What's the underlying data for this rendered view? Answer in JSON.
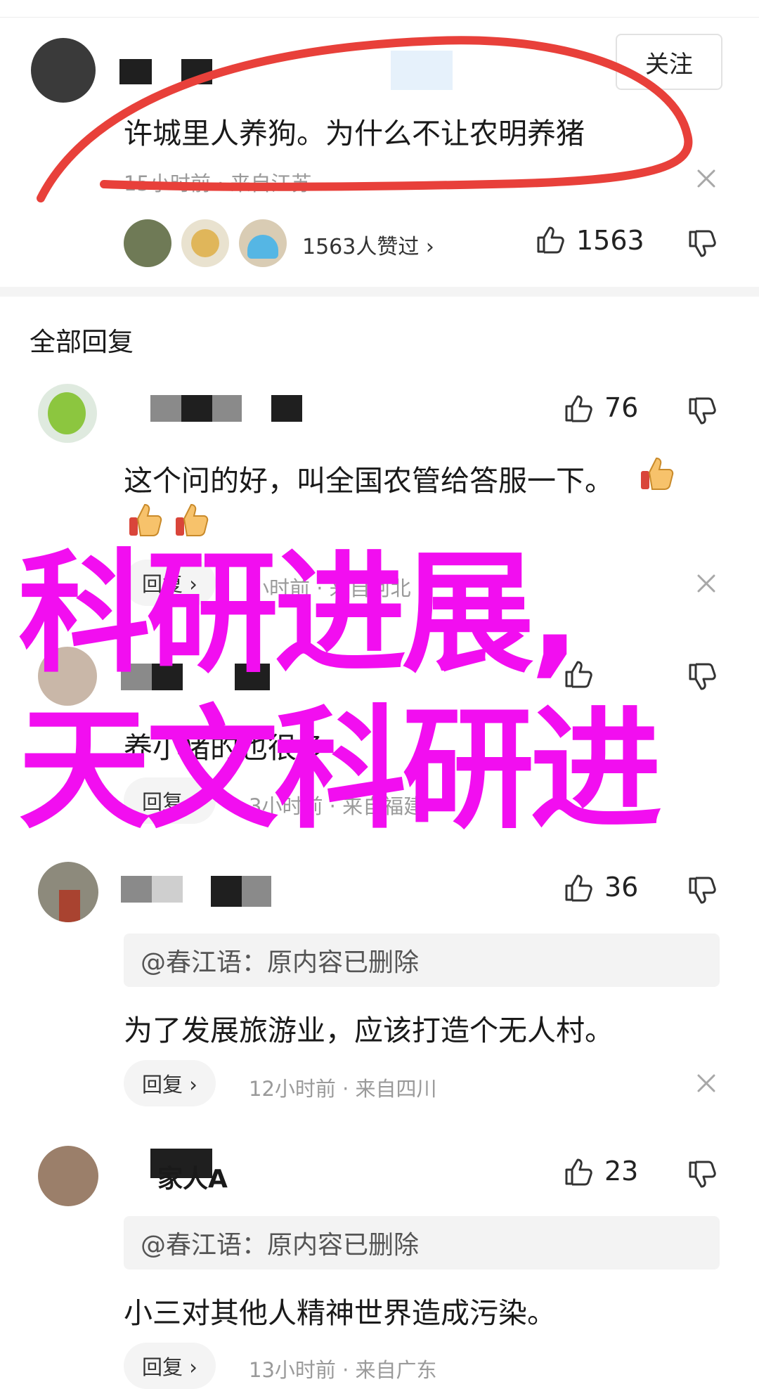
{
  "colors": {
    "watermark": "#f20ef0",
    "annotation": "#e8403a",
    "meta": "#9a9a9a"
  },
  "top_comment": {
    "text": "许城里人养狗。为什么不让农明养猪",
    "meta": "15小时前 · 来自江苏",
    "follow_label": "关注",
    "likers_text": "1563人赞过 ›",
    "like_count": "1563"
  },
  "section_title": "全部回复",
  "replies": [
    {
      "likes": "76",
      "text_line1": "这个问的好，叫全国农管给答服一下。",
      "reply_label": "回复 ›",
      "meta": "小时前 · 来自河北"
    },
    {
      "likes": "",
      "text": "养小猪的也很多",
      "reply_label": "回复 ›",
      "meta": "3小时前 · 来自福建"
    },
    {
      "likes": "36",
      "quote": "@春江语：原内容已删除",
      "text": "为了发展旅游业，应该打造个无人村。",
      "reply_label": "回复 ›",
      "meta": "12小时前 · 来自四川"
    },
    {
      "username": "家人A",
      "likes": "23",
      "quote": "@春江语：原内容已删除",
      "text": "小三对其他人精神世界造成污染。",
      "reply_label": "回复 ›",
      "meta": "13小时前 · 来自广东"
    }
  ],
  "watermark": {
    "line1": "科研进展,",
    "line2": "天文科研进"
  },
  "icons": [
    "thumbs-up-icon",
    "thumbs-down-icon",
    "close-icon",
    "thumbs-up-emoji-icon"
  ]
}
